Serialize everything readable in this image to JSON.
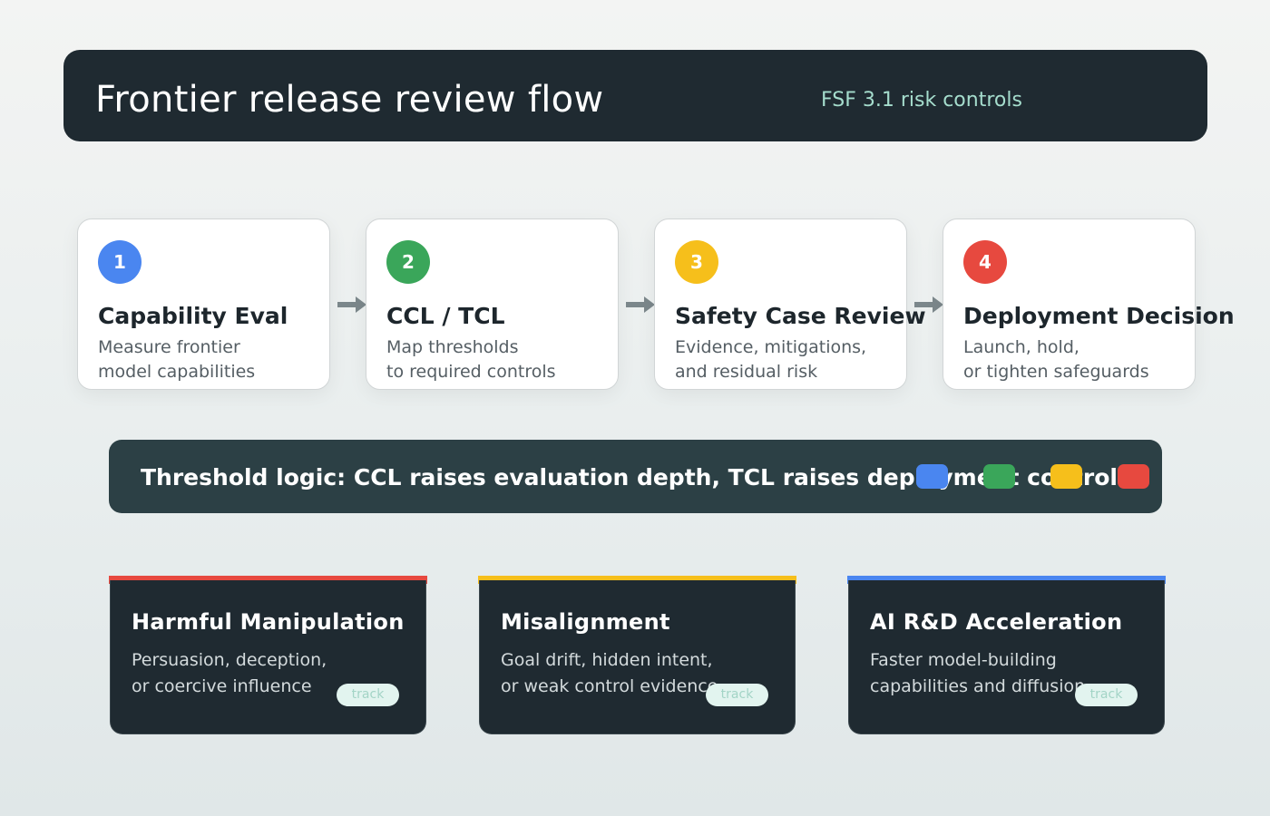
{
  "header": {
    "title": "Frontier release review flow",
    "subtitle": "FSF 3.1 risk controls"
  },
  "steps": [
    {
      "number": "1",
      "title": "Capability Eval",
      "desc_line1": "Measure frontier",
      "desc_line2": "model capabilities",
      "color": "#4a86f0"
    },
    {
      "number": "2",
      "title": "CCL / TCL",
      "desc_line1": "Map thresholds",
      "desc_line2": "to required controls",
      "color": "#3aa65a"
    },
    {
      "number": "3",
      "title": "Safety Case Review",
      "desc_line1": "Evidence, mitigations,",
      "desc_line2": "and residual risk",
      "color": "#f6bf1b"
    },
    {
      "number": "4",
      "title": "Deployment Decision",
      "desc_line1": "Launch, hold,",
      "desc_line2": "or tighten safeguards",
      "color": "#e7493f"
    }
  ],
  "arrow_icon": "right-arrow-icon",
  "logic": {
    "text": "Threshold logic: CCL raises evaluation depth, TCL raises deployment controls",
    "legend_colors": [
      "#4a86f0",
      "#3aa65a",
      "#f6bf1b",
      "#e7493f"
    ]
  },
  "risks": [
    {
      "title": "Harmful Manipulation",
      "desc_line1": "Persuasion, deception,",
      "desc_line2": "or coercive influence",
      "tag": "track",
      "accent": "#e7493f"
    },
    {
      "title": "Misalignment",
      "desc_line1": "Goal drift, hidden intent,",
      "desc_line2": "or weak control evidence",
      "tag": "track",
      "accent": "#f6bf1b"
    },
    {
      "title": "AI R&D Acceleration",
      "desc_line1": "Faster model-building",
      "desc_line2": "capabilities and diffusion",
      "tag": "track",
      "accent": "#4a86f0"
    }
  ]
}
